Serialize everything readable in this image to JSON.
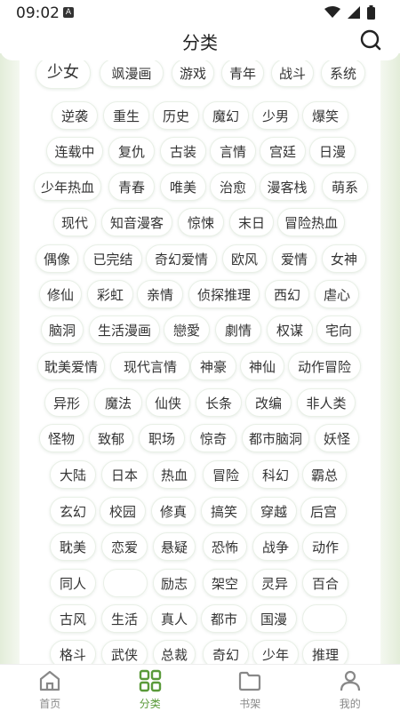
{
  "status": {
    "time": "09:02",
    "notif_badge": "A"
  },
  "header": {
    "title": "分类"
  },
  "tag_rows": [
    [
      "少女",
      "飒漫画",
      "游戏",
      "青年",
      "战斗",
      "系统"
    ],
    [
      "逆袭",
      "重生",
      "历史",
      "魔幻",
      "少男",
      "爆笑"
    ],
    [
      "连载中",
      "复仇",
      "古装",
      "言情",
      "宫廷",
      "日漫"
    ],
    [
      "少年热血",
      "青春",
      "唯美",
      "治愈",
      "漫客栈",
      "萌系"
    ],
    [
      "现代",
      "知音漫客",
      "惊悚",
      "末日",
      "冒险热血"
    ],
    [
      "偶像",
      "已完结",
      "奇幻爱情",
      "欧风",
      "爱情",
      "女神"
    ],
    [
      "修仙",
      "彩虹",
      "亲情",
      "侦探推理",
      "西幻",
      "虐心"
    ],
    [
      "脑洞",
      "生活漫画",
      "戀愛",
      "劇情",
      "权谋",
      "宅向"
    ],
    [
      "耽美爱情",
      "现代言情",
      "神豪",
      "神仙",
      "动作冒险"
    ],
    [
      "异形",
      "魔法",
      "仙侠",
      "长条",
      "改编",
      "非人类"
    ],
    [
      "怪物",
      "致郁",
      "职场",
      "惊奇",
      "都市脑洞",
      "妖怪"
    ],
    [
      "大陆",
      "日本",
      "热血",
      "冒险",
      "科幻",
      "霸总"
    ],
    [
      "玄幻",
      "校园",
      "修真",
      "搞笑",
      "穿越",
      "后宫"
    ],
    [
      "耽美",
      "恋爱",
      "悬疑",
      "恐怖",
      "战争",
      "动作"
    ],
    [
      "同人",
      "",
      "励志",
      "架空",
      "灵异",
      "百合"
    ],
    [
      "古风",
      "生活",
      "真人",
      "都市",
      "国漫",
      ""
    ],
    [
      "格斗",
      "武侠",
      "总裁",
      "奇幻",
      "少年",
      "推理"
    ]
  ],
  "tabs": [
    {
      "label": "首页",
      "icon": "home-icon",
      "active": false
    },
    {
      "label": "分类",
      "icon": "category-grid-icon",
      "active": true
    },
    {
      "label": "书架",
      "icon": "bookshelf-folder-icon",
      "active": false
    },
    {
      "label": "我的",
      "icon": "profile-icon",
      "active": false
    }
  ],
  "colors": {
    "accent": "#5a9a3a",
    "side_tint": "#e3edd9",
    "inactive": "#888888"
  }
}
